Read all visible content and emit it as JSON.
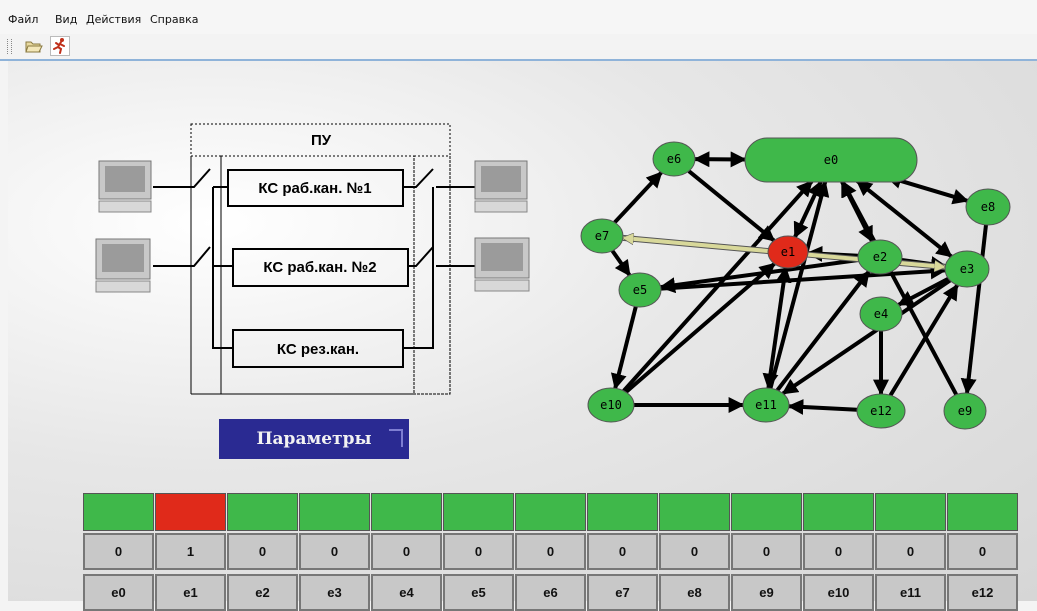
{
  "menu": [
    "Файл",
    "Вид",
    "Действия",
    "Справка"
  ],
  "toolbar": {
    "icons": [
      "open-folder-icon",
      "run-icon"
    ]
  },
  "scheme": {
    "pu_label": "ПУ",
    "channels": [
      "КС раб.кан. №1",
      "КС раб.кан. №2",
      "КС рез.кан."
    ]
  },
  "params_button": "Параметры",
  "graph": {
    "nodes": [
      {
        "id": "e0",
        "label": "e0",
        "status": "ok"
      },
      {
        "id": "e1",
        "label": "e1",
        "status": "fail"
      },
      {
        "id": "e2",
        "label": "e2",
        "status": "ok"
      },
      {
        "id": "e3",
        "label": "e3",
        "status": "ok"
      },
      {
        "id": "e4",
        "label": "e4",
        "status": "ok"
      },
      {
        "id": "e5",
        "label": "e5",
        "status": "ok"
      },
      {
        "id": "e6",
        "label": "e6",
        "status": "ok"
      },
      {
        "id": "e7",
        "label": "e7",
        "status": "ok"
      },
      {
        "id": "e8",
        "label": "e8",
        "status": "ok"
      },
      {
        "id": "e9",
        "label": "e9",
        "status": "ok"
      },
      {
        "id": "e10",
        "label": "e10",
        "status": "ok"
      },
      {
        "id": "e11",
        "label": "e11",
        "status": "ok"
      },
      {
        "id": "e12",
        "label": "e12",
        "status": "ok"
      }
    ],
    "edges": [
      [
        "e6",
        "e0",
        "both"
      ],
      [
        "e0",
        "e1",
        "both"
      ],
      [
        "e6",
        "e1",
        "to"
      ],
      [
        "e7",
        "e6",
        "to"
      ],
      [
        "e7",
        "e5",
        "to"
      ],
      [
        "e2",
        "e1",
        "to"
      ],
      [
        "e2",
        "e5",
        "to"
      ],
      [
        "e5",
        "e3",
        "to"
      ],
      [
        "e0",
        "e2",
        "both"
      ],
      [
        "e0",
        "e3",
        "both"
      ],
      [
        "e0",
        "e8",
        "both"
      ],
      [
        "e2",
        "e3",
        "to"
      ],
      [
        "e3",
        "e4",
        "to"
      ],
      [
        "e4",
        "e12",
        "to"
      ],
      [
        "e12",
        "e3",
        "to"
      ],
      [
        "e3",
        "e11",
        "to"
      ],
      [
        "e8",
        "e9",
        "to"
      ],
      [
        "e0",
        "e9",
        "from"
      ],
      [
        "e5",
        "e10",
        "to"
      ],
      [
        "e10",
        "e1",
        "to"
      ],
      [
        "e10",
        "e11",
        "to"
      ],
      [
        "e12",
        "e11",
        "to"
      ],
      [
        "e11",
        "e1",
        "both"
      ],
      [
        "e11",
        "e0",
        "to"
      ],
      [
        "e11",
        "e2",
        "to"
      ],
      [
        "e10",
        "e0",
        "to"
      ]
    ],
    "highlight_edge": [
      "e7",
      "e3"
    ]
  },
  "status_table": {
    "names": [
      "e0",
      "e1",
      "e2",
      "e3",
      "e4",
      "e5",
      "e6",
      "e7",
      "e8",
      "e9",
      "e10",
      "e11",
      "e12"
    ],
    "values": [
      "0",
      "1",
      "0",
      "0",
      "0",
      "0",
      "0",
      "0",
      "0",
      "0",
      "0",
      "0",
      "0"
    ]
  },
  "colors": {
    "ok": "#3fb84a",
    "fail": "#e02a1a",
    "button": "#2a2a92",
    "highlight": "#d8d89a"
  }
}
